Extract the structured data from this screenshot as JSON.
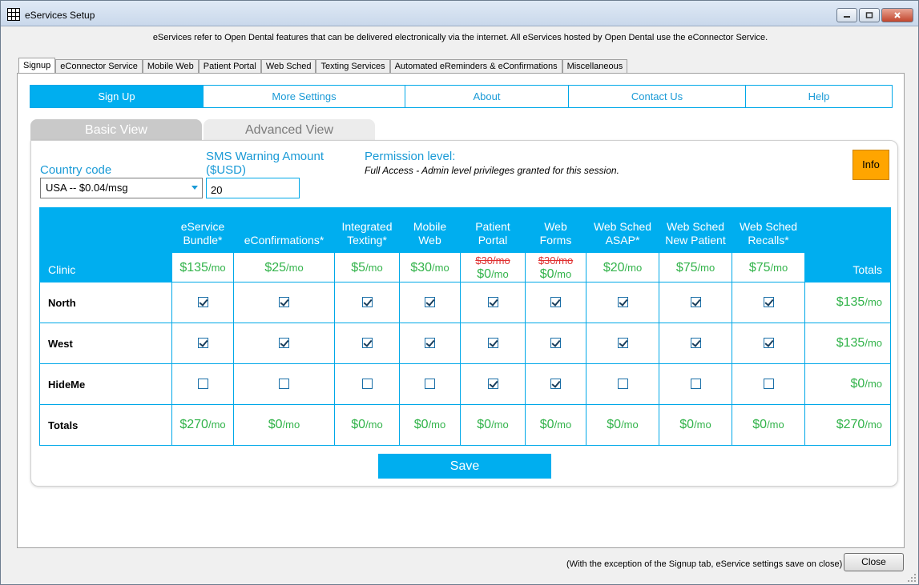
{
  "window": {
    "title": "eServices Setup"
  },
  "info_line": "eServices refer to Open Dental features that can be delivered electronically via the internet.  All eServices hosted by Open Dental use the eConnector Service.",
  "tabs": [
    "Signup",
    "eConnector Service",
    "Mobile Web",
    "Patient Portal",
    "Web Sched",
    "Texting Services",
    "Automated eReminders & eConfirmations",
    "Miscellaneous"
  ],
  "active_tab": "Signup",
  "nav": {
    "sign_up": "Sign Up",
    "more_settings": "More Settings",
    "about": "About",
    "contact_us": "Contact Us",
    "help": "Help"
  },
  "view_tabs": {
    "basic": "Basic View",
    "advanced": "Advanced View"
  },
  "form": {
    "country_label": "Country code",
    "country_value": "USA -- $0.04/msg",
    "sms_label_line1": "SMS Warning Amount",
    "sms_label_line2": "($USD)",
    "sms_value": "20",
    "permission_label": "Permission level:",
    "permission_value": "Full Access - Admin level privileges granted for this session.",
    "info_button": "Info"
  },
  "grid": {
    "clinic_header": "Clinic",
    "totals_header": "Totals",
    "columns": [
      {
        "l1": "eService",
        "l2": "Bundle*",
        "price": "$135",
        "unit": "/mo",
        "strike": ""
      },
      {
        "l1": "",
        "l2": "eConfirmations*",
        "price": "$25",
        "unit": "/mo",
        "strike": ""
      },
      {
        "l1": "Integrated",
        "l2": "Texting*",
        "price": "$5",
        "unit": "/mo",
        "strike": ""
      },
      {
        "l1": "Mobile",
        "l2": "Web",
        "price": "$30",
        "unit": "/mo",
        "strike": ""
      },
      {
        "l1": "Patient",
        "l2": "Portal",
        "price": "$0",
        "unit": "/mo",
        "strike": "$30/mo"
      },
      {
        "l1": "Web",
        "l2": "Forms",
        "price": "$0",
        "unit": "/mo",
        "strike": "$30/mo"
      },
      {
        "l1": "Web Sched",
        "l2": "ASAP*",
        "price": "$20",
        "unit": "/mo",
        "strike": ""
      },
      {
        "l1": "Web Sched",
        "l2": "New Patient",
        "price": "$75",
        "unit": "/mo",
        "strike": ""
      },
      {
        "l1": "Web Sched",
        "l2": "Recalls*",
        "price": "$75",
        "unit": "/mo",
        "strike": ""
      }
    ],
    "rows": [
      {
        "name": "North",
        "checks": [
          true,
          true,
          true,
          true,
          true,
          true,
          true,
          true,
          true
        ],
        "total": "$135",
        "unit": "/mo"
      },
      {
        "name": "West",
        "checks": [
          true,
          true,
          true,
          true,
          true,
          true,
          true,
          true,
          true
        ],
        "total": "$135",
        "unit": "/mo"
      },
      {
        "name": "HideMe",
        "checks": [
          false,
          false,
          false,
          false,
          true,
          true,
          false,
          false,
          false
        ],
        "total": "$0",
        "unit": "/mo"
      }
    ],
    "totals_row": {
      "name": "Totals",
      "values": [
        "$270",
        "$0",
        "$0",
        "$0",
        "$0",
        "$0",
        "$0",
        "$0",
        "$0"
      ],
      "unit": "/mo",
      "grand_total": "$270"
    }
  },
  "save_button": "Save",
  "footer": {
    "note": "(With the exception of the Signup tab, eService settings save on close)",
    "close_button": "Close"
  },
  "colors": {
    "accent": "#00aeef",
    "price_green": "#32b34a",
    "strike_red": "#e03131",
    "info_orange": "#ffa500"
  }
}
